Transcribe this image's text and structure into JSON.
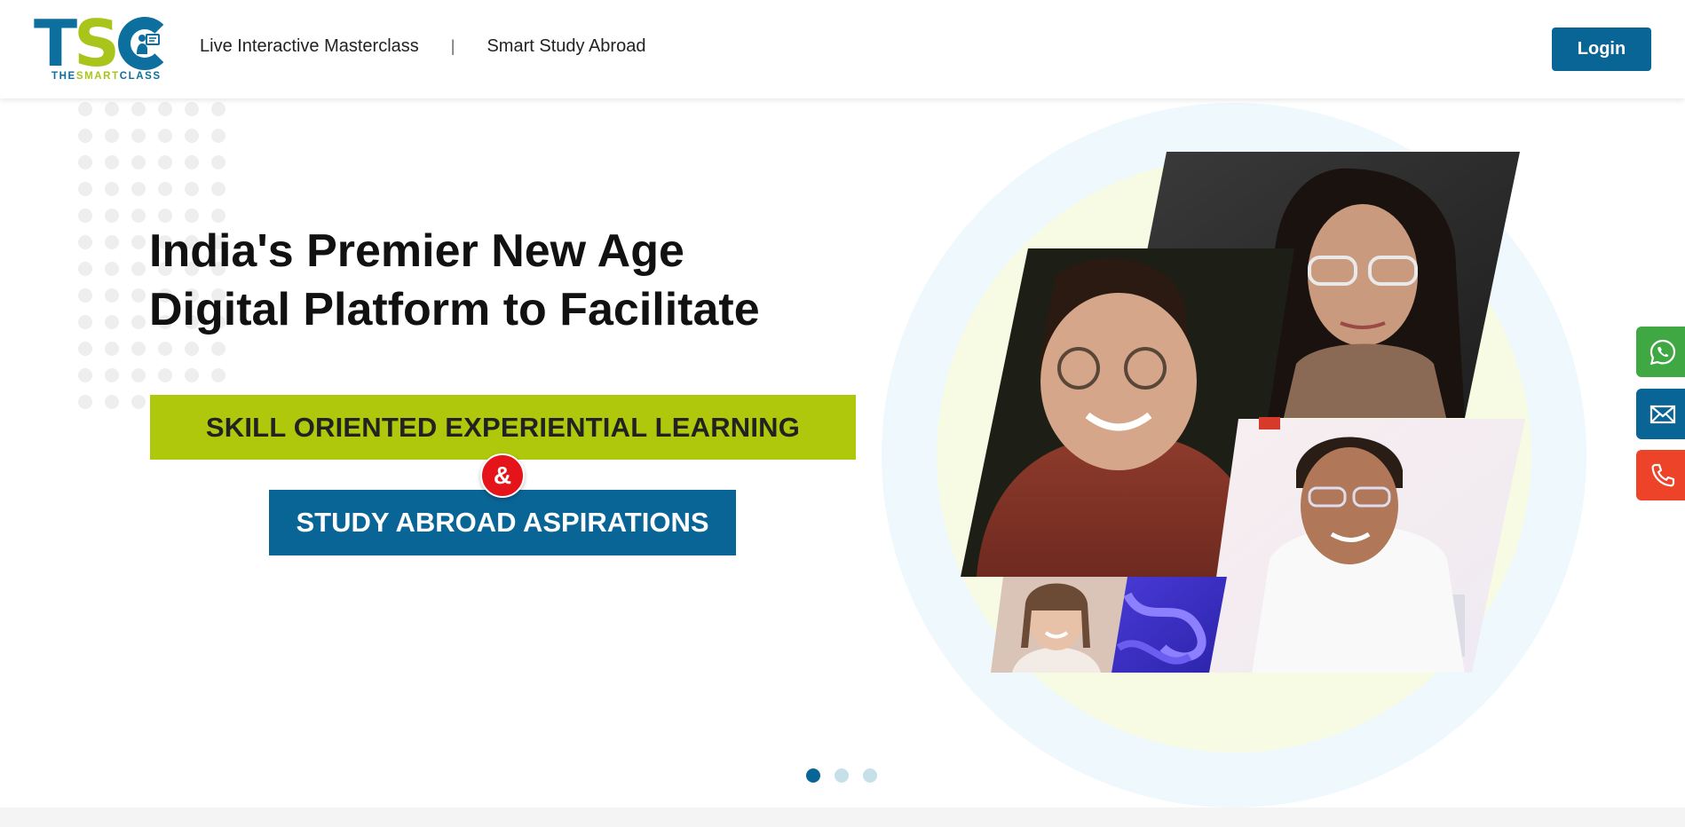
{
  "brand": {
    "logo_letters": {
      "t": "T",
      "s": "S"
    },
    "tagline_part1": "THE",
    "tagline_part2": "SMART",
    "tagline_part3": "CLASS",
    "colors": {
      "primary": "#0a6597",
      "accent": "#afc80b",
      "red": "#e5141b"
    }
  },
  "nav": {
    "items": [
      {
        "label": "Live Interactive Masterclass"
      },
      {
        "label": "Smart Study Abroad"
      }
    ],
    "separator": "|"
  },
  "header": {
    "login_label": "Login"
  },
  "hero": {
    "headline_line1": "India's Premier New Age",
    "headline_line2": "Digital Platform to Facilitate",
    "skill_banner": "SKILL ORIENTED EXPERIENTIAL LEARNING",
    "ampersand": "&",
    "study_banner": "STUDY ABROAD ASPIRATIONS",
    "carousel": {
      "slides": 3,
      "active_index": 0
    }
  },
  "contact_buttons": [
    {
      "icon": "whatsapp-icon",
      "color": "#3fa843"
    },
    {
      "icon": "mail-icon",
      "color": "#0a6597"
    },
    {
      "icon": "phone-icon",
      "color": "#ed4328"
    }
  ]
}
